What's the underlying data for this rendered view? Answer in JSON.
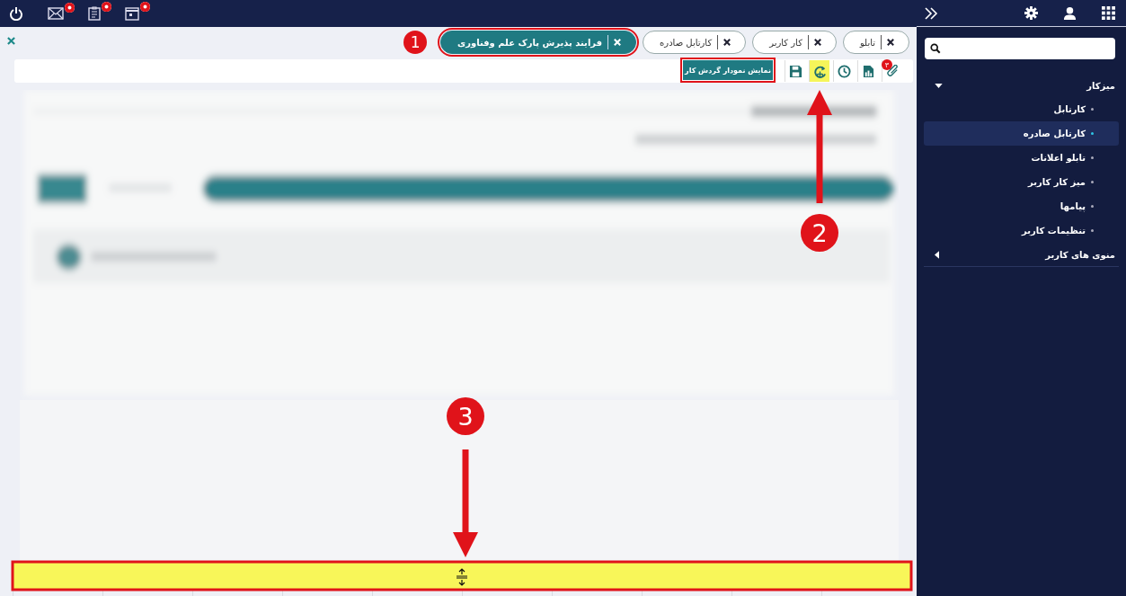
{
  "top_bar": {
    "notifications": [
      {
        "kind": "mail",
        "badge": true
      },
      {
        "kind": "clipboard",
        "badge": true
      },
      {
        "kind": "calendar",
        "badge": true
      }
    ]
  },
  "tabs": [
    {
      "label": "تابلو",
      "selected": false
    },
    {
      "label": "کار کاربر",
      "selected": false
    },
    {
      "label": "کارتابل صادره",
      "selected": false
    },
    {
      "label": "فرایند پذیرش پارک علم وفناوری",
      "selected": true
    }
  ],
  "tooltip": "نمایش نمودار گردش کار",
  "toolbar": [
    {
      "kind": "attach",
      "badge": "۳",
      "highlighted": false
    },
    {
      "kind": "report",
      "highlighted": false
    },
    {
      "kind": "history",
      "highlighted": false
    },
    {
      "kind": "workflow",
      "highlighted": true
    },
    {
      "kind": "save",
      "highlighted": false
    }
  ],
  "splitter": {
    "highlighted": true
  },
  "sidebar": {
    "menu": [
      {
        "label": "میزکار",
        "expanded": true,
        "children": [
          {
            "label": "کارتابل",
            "selected": false
          },
          {
            "label": "کارتابل صادره",
            "selected": true
          },
          {
            "label": "تابلو اعلانات",
            "selected": false
          },
          {
            "label": "میز کار کاربر",
            "selected": false
          },
          {
            "label": "پیامها",
            "selected": false
          },
          {
            "label": "تنظیمات کاربر",
            "selected": false
          }
        ]
      },
      {
        "label": "منوی های کاربر",
        "expanded": false
      }
    ]
  },
  "annotations": [
    "1",
    "2",
    "3"
  ]
}
